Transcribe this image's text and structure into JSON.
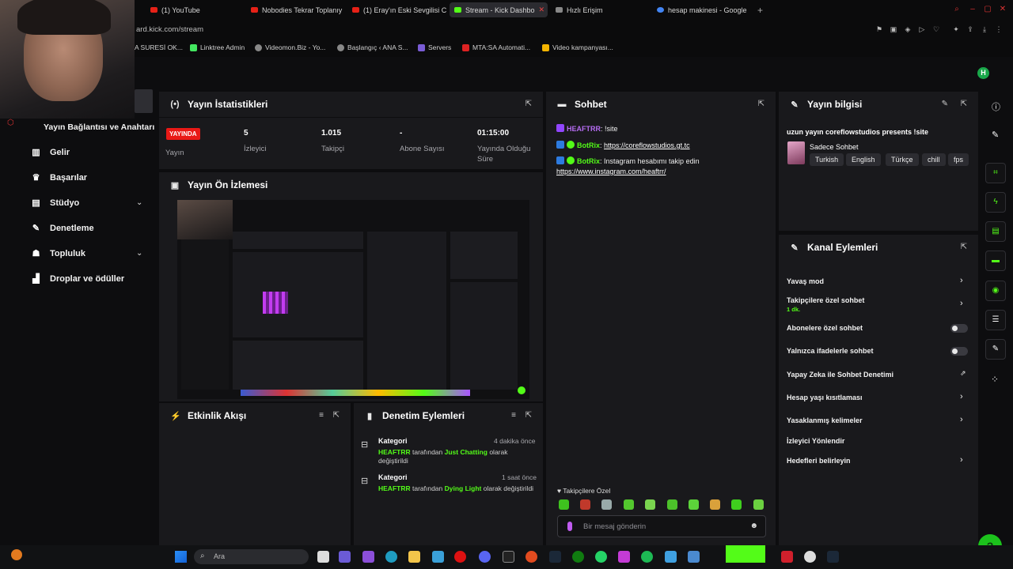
{
  "browser": {
    "tabs": [
      {
        "label": "(1) YouTube",
        "active": false
      },
      {
        "label": "Nobodies Tekrar Toplanıy",
        "active": false
      },
      {
        "label": "(1) Eray'ın Eski Sevgilisi Ci",
        "active": false
      },
      {
        "label": "Stream - Kick Dashbo",
        "active": true
      },
      {
        "label": "Hızlı Erişim",
        "active": false
      },
      {
        "label": "hesap makinesi - Google",
        "active": false
      }
    ],
    "address": "ard.kick.com/stream",
    "bookmarks": [
      "A SURESİ OK...",
      "Linktree Admin",
      "Videomon.Biz - Yo...",
      "Başlangıç ‹ ANA S...",
      "Servers",
      "MTA:SA Automati...",
      "Video kampanyası..."
    ]
  },
  "header": {
    "avatar_letter": "H"
  },
  "sidebar": {
    "title": "Yayın Bağlantısı ve Anahtarı",
    "items": [
      {
        "label": "Gelir",
        "icon": "chart-icon"
      },
      {
        "label": "Başarılar",
        "icon": "trophy-icon"
      },
      {
        "label": "Stüdyo",
        "icon": "studio-icon",
        "expandable": true
      },
      {
        "label": "Denetleme",
        "icon": "wrench-icon"
      },
      {
        "label": "Topluluk",
        "icon": "community-icon",
        "expandable": true
      },
      {
        "label": "Droplar ve ödüller",
        "icon": "drops-icon"
      }
    ]
  },
  "stats": {
    "title": "Yayın İstatistikleri",
    "live_badge": "YAYINDA",
    "live_label": "Yayın",
    "viewers": {
      "value": "5",
      "label": "İzleyici"
    },
    "followers": {
      "value": "1.015",
      "label": "Takipçi"
    },
    "subs": {
      "value": "-",
      "label": "Abone Sayısı"
    },
    "uptime": {
      "value": "01:15:00",
      "label": "Yayında Olduğu Süre"
    }
  },
  "preview": {
    "title": "Yayın Ön İzlemesi"
  },
  "chat": {
    "title": "Sohbet",
    "messages": [
      {
        "user": "HEAFTRR",
        "text": "!site",
        "color": "#b56cf2"
      },
      {
        "user": "BotRix",
        "text": "",
        "link": "https://coreflowstudios.gt.tc",
        "color": "#53fc18"
      },
      {
        "user": "BotRix",
        "text": "Instagram hesabımı takip edin",
        "link": "https://www.instagram.com/heaftrr/",
        "color": "#53fc18"
      }
    ],
    "mode": "Takipçilere Özel",
    "placeholder": "Bir mesaj gönderin"
  },
  "stream_info": {
    "title": "Yayın bilgisi",
    "stream_title": "uzun yayın coreflowstudios presents !site",
    "category": "Sadece Sohbet",
    "tags": [
      "Turkish",
      "English",
      "Türkçe",
      "chill",
      "fps"
    ]
  },
  "channel_actions": {
    "title": "Kanal Eylemleri",
    "items": [
      {
        "label": "Yavaş mod",
        "control": "arrow"
      },
      {
        "label": "Takipçilere özel sohbet",
        "sub": "1 dk.",
        "control": "arrow"
      },
      {
        "label": "Abonelere özel sohbet",
        "control": "toggle"
      },
      {
        "label": "Yalnızca ifadelerle sohbet",
        "control": "toggle"
      },
      {
        "label": "Yapay Zeka ile Sohbet Denetimi",
        "control": "external"
      },
      {
        "label": "Hesap yaşı kısıtlaması",
        "control": "arrow"
      },
      {
        "label": "Yasaklanmış kelimeler",
        "control": "arrow"
      },
      {
        "label": "İzleyici Yönlendir",
        "control": "none"
      },
      {
        "label": "Hedefleri belirleyin",
        "control": "arrow"
      }
    ]
  },
  "activity": {
    "title": "Etkinlik Akışı"
  },
  "mod_actions": {
    "title": "Denetim Eylemleri",
    "items": [
      {
        "type": "Kategori",
        "time": "4 dakika önce",
        "user": "HEAFTRR",
        "middle": "tarafından",
        "category": "Just Chatting",
        "rest": "olarak değiştirildi"
      },
      {
        "type": "Kategori",
        "time": "1 saat önce",
        "user": "HEAFTRR",
        "middle": "tarafından",
        "category": "Dying Light",
        "rest": "olarak değiştirildi"
      }
    ]
  },
  "taskbar": {
    "search_placeholder": "Ara"
  },
  "colors": {
    "accent": "#53fc18",
    "live": "#e91916",
    "panel": "#19191c",
    "background": "#0d0d0f"
  }
}
